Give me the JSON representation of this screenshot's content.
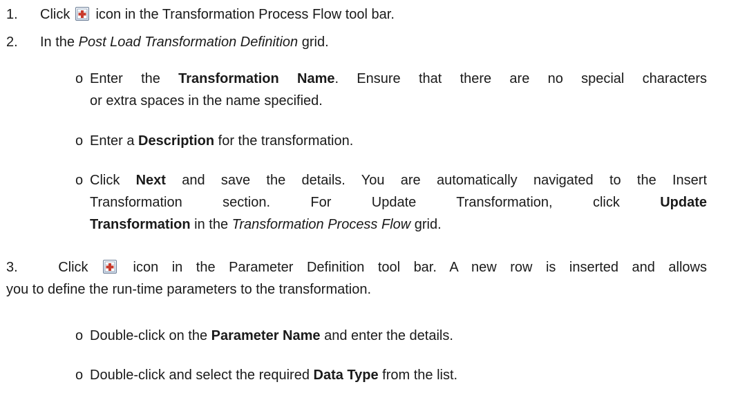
{
  "colors": {
    "text": "#1a1a1a",
    "icon_border": "#6d7f96",
    "icon_plus": "#c83a2c"
  },
  "icons": {
    "toolbar_add": "add-row-icon"
  },
  "steps": [
    {
      "number": "1.",
      "parts": {
        "before": "Click",
        "after": "icon in the Transformation Process Flow tool bar."
      }
    },
    {
      "number": "2.",
      "parts": {
        "before": "In the ",
        "em": "Post Load Transformation Definition",
        "after": " grid."
      },
      "bullets": [
        {
          "marker": "o",
          "text1": "Enter the ",
          "b1": "Transformation Name",
          "text2": ". Ensure that there are no special characters",
          "line2": "or extra spaces in the name specified."
        },
        {
          "marker": "o",
          "text1": "Enter a ",
          "b1": "Description",
          "text2": " for the transformation."
        },
        {
          "marker": "o",
          "text1": "Click ",
          "b1": "Next",
          "text2": " and save the details. You are automatically navigated to the Insert",
          "line2a": "Transformation section. For Update Transformation, click ",
          "b2": "Update",
          "line3b": "Transformation",
          "line3c": " in the ",
          "em3": "Transformation Process Flow",
          "line3d": " grid."
        }
      ]
    },
    {
      "number": "3.",
      "parts": {
        "before": "Click",
        "after": "icon in the Parameter Definition tool bar. A new row is inserted and allows",
        "line2": "you to define the run-time parameters to the transformation."
      },
      "bullets": [
        {
          "marker": "o",
          "text1": "Double-click on the ",
          "b1": "Parameter Name",
          "text2": " and enter the details."
        },
        {
          "marker": "o",
          "text1": "Double-click and select the required ",
          "b1": "Data Type",
          "text2": " from the list."
        }
      ]
    }
  ]
}
